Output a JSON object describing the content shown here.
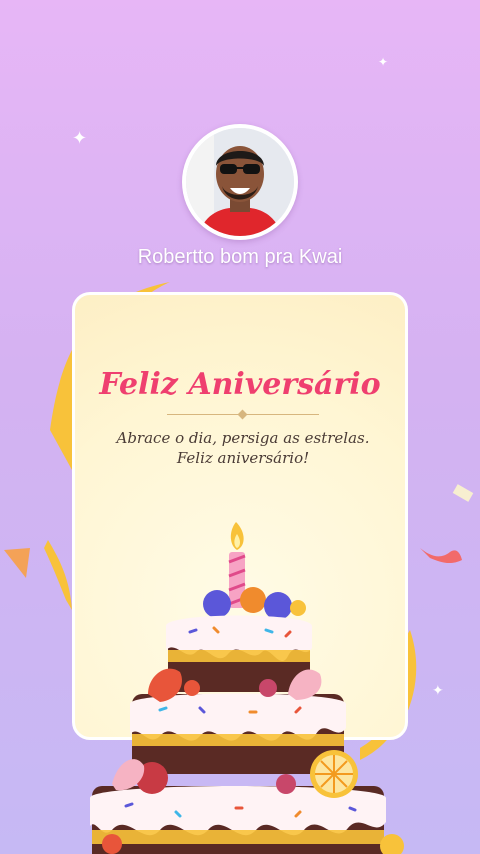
{
  "profile": {
    "username": "Robertto bom pra Kwai"
  },
  "card": {
    "title": "Feliz Aniversário",
    "message": "Abrace o dia, persiga as estrelas. Feliz aniversário!"
  },
  "colors": {
    "background_top": "#e7b6f6",
    "background_bottom": "#c6b9f4",
    "title": "#ef3f6f",
    "ribbon": "#f8c23a"
  },
  "icons": [
    "sparkle-icon",
    "birthday-cake-illustration",
    "avatar"
  ]
}
